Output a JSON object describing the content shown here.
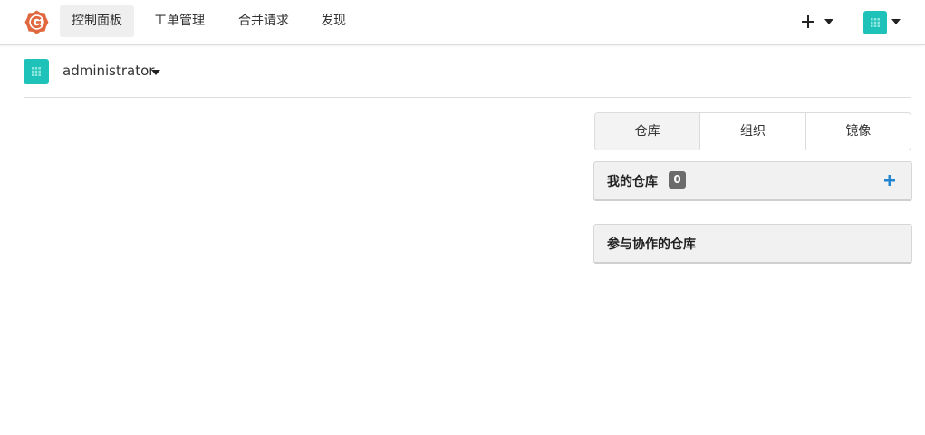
{
  "navbar": {
    "logo_icon": "gitea-logo-icon",
    "items": [
      {
        "label": "控制面板",
        "active": true
      },
      {
        "label": "工单管理",
        "active": false
      },
      {
        "label": "合并请求",
        "active": false
      },
      {
        "label": "发现",
        "active": false
      }
    ],
    "create_icon": "plus-icon",
    "avatar_icon": "user-avatar-icon"
  },
  "context": {
    "user_name": "administrator"
  },
  "tabs": [
    {
      "label": "仓库",
      "active": true
    },
    {
      "label": "组织",
      "active": false
    },
    {
      "label": "镜像",
      "active": false
    }
  ],
  "panels": {
    "my_repos": {
      "title": "我的仓库",
      "count": "0",
      "add_icon": "plus-icon"
    },
    "collab_repos": {
      "title": "参与协作的仓库"
    }
  },
  "colors": {
    "accent": "#2185d0",
    "avatar": "#1fc2b8",
    "logo": "#e0673e"
  }
}
